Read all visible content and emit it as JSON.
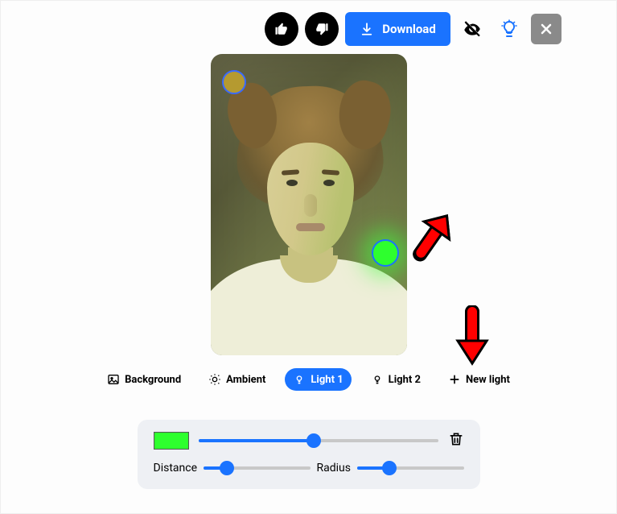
{
  "toolbar": {
    "download_label": "Download"
  },
  "tabs": {
    "background": "Background",
    "ambient": "Ambient",
    "light1": "Light 1",
    "light2": "Light 2",
    "new_light": "New light"
  },
  "controls": {
    "swatch_color": "#2eff2e",
    "intensity_pct": 48,
    "distance_label": "Distance",
    "distance_pct": 22,
    "radius_label": "Radius",
    "radius_pct": 30
  },
  "canvas": {
    "ambient_color": "#b59a30",
    "light1_color": "#2eff2e"
  }
}
